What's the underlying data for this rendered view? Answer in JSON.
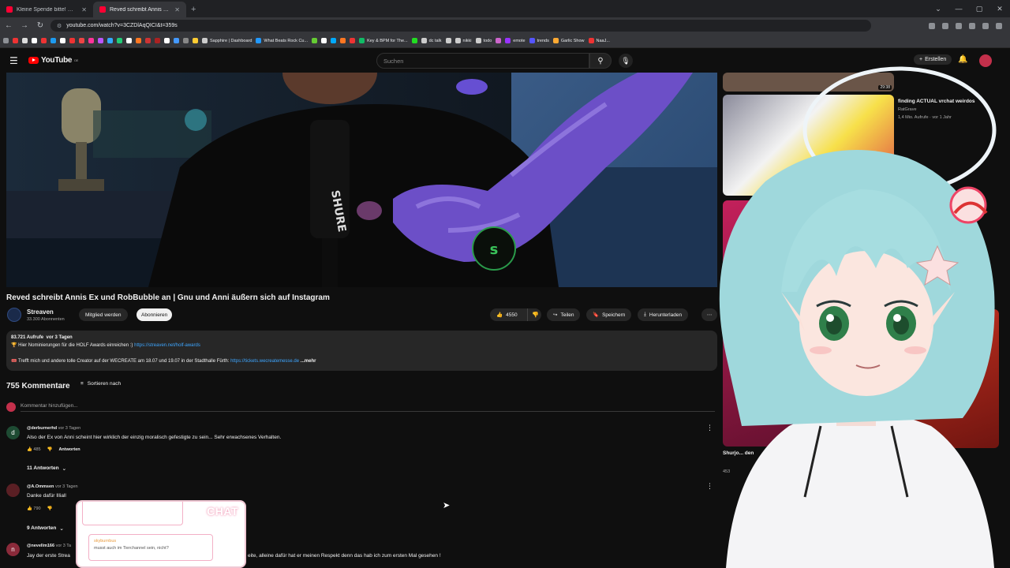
{
  "browser": {
    "tabs": [
      {
        "title": "Kleine Spende bitte! Meme #",
        "active": false
      },
      {
        "title": "Reved schreibt Annis Ex und R",
        "active": true
      }
    ],
    "url": "youtube.com/watch?v=3CZDlAqQICI&t=359s",
    "bookmarks": [
      "Sapphire | Dashboard",
      "What Beats Rock Cu...",
      "Key & BPM for The...",
      "dc talk",
      "nikki",
      "todo",
      "emote",
      "trends",
      "Garlic Show",
      "NaaJ..."
    ]
  },
  "youtube": {
    "logo": "YouTube",
    "logo_region": "DE",
    "search_placeholder": "Suchen",
    "create_label": "Erstellen"
  },
  "video": {
    "title": "Reved schreibt Annis Ex und RobBubble an | Gnu und Anni äußern sich auf Instagram",
    "channel": "Streaven",
    "subscribers": "33.300 Abonnenten",
    "member_label": "Mitglied werden",
    "subscribe_label": "Abonnieren",
    "likes": "4550",
    "share_label": "Teilen",
    "save_label": "Speichern",
    "download_label": "Herunterladen",
    "mic_brand": "SHURE"
  },
  "description": {
    "views": "83.721 Aufrufe",
    "age": "vor 3 Tagen",
    "line1": "🏆 Hier Nominierungen für die HOLF Awards einreichen :)",
    "link1": "https://streaven.net/holf-awards",
    "line2": "🎟️ Trefft mich und andere tolle Creator auf der WECREATE am 18.07 und 19.07 in der Stadthalle Fürth:",
    "link2": "https://tickets.wecreatemesse.de",
    "more": "...mehr"
  },
  "comments": {
    "count": "755 Kommentare",
    "sort_label": "Sortieren nach",
    "add_placeholder": "Kommentar hinzufügen...",
    "reply_label": "Antworten",
    "items": [
      {
        "avatar": "d",
        "author": "@derburnerhd",
        "time": "vor 3 Tagen",
        "text": "Also der Ex von Anni scheint hier wirklich der einzig moralisch gefestigte zu sein... Sehr erwachsenes Verhalten.",
        "likes": "485",
        "replies": "11 Antworten"
      },
      {
        "avatar": "",
        "author": "@A.Ommsen",
        "time": "vor 3 Tagen",
        "text": "Danke dafür Illiall",
        "likes": "790",
        "replies": "9 Antworten"
      },
      {
        "avatar": "n",
        "author": "@nevellm166",
        "time": "vor 3 Ta",
        "text": "Jay der erste Strea",
        "text_tail": "eite, alleine dafür hat er meinen Respekt denn das hab ich zum ersten Mal gesehen !"
      }
    ]
  },
  "sidebar": {
    "items": [
      {
        "title": "",
        "duration": "29:38"
      },
      {
        "title": "finding ACTUAL vrchat weirdos",
        "channel": "RatGrave",
        "meta": "1,4 Mio. Aufrufe · vor 1 Jahr"
      },
      {
        "title": "Shurjo... den",
        "meta": "453"
      }
    ]
  },
  "overlay": {
    "chat_title": "CHAT",
    "chat_user": "skyburnbus",
    "chat_message": "musst auch im Tierchannel sein, nicht?"
  },
  "colors": {
    "yt_red": "#ff0000",
    "link_blue": "#3ea6ff",
    "bg": "#0f0f0f"
  }
}
